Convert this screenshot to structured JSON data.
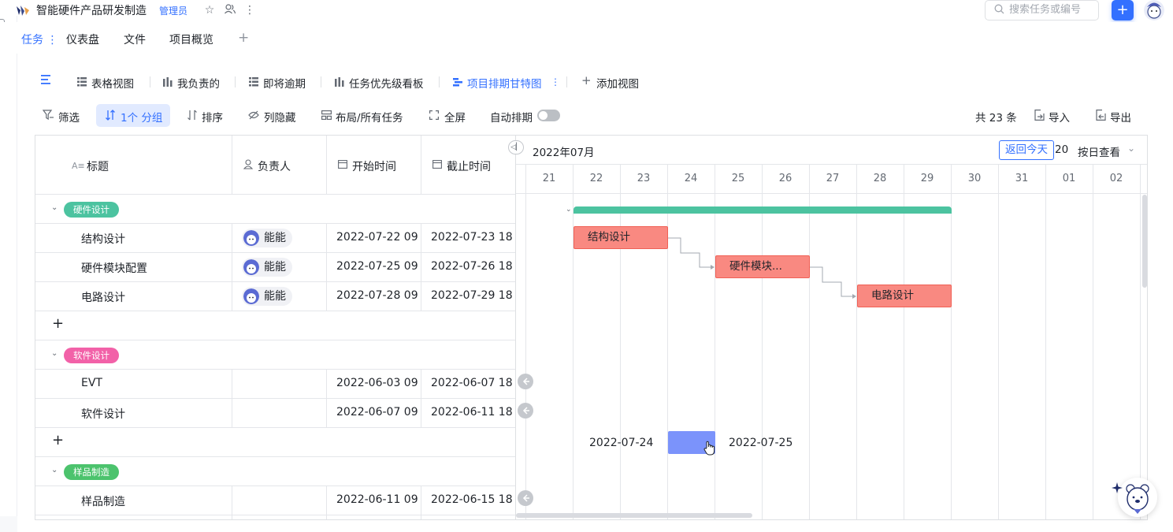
{
  "app": {
    "title": "智能硬件产品研发制造",
    "role": "管理员",
    "search_placeholder": "搜索任务或编号",
    "plus": "+"
  },
  "tabs": [
    {
      "label": "任务 ⋮",
      "active": true
    },
    {
      "label": "仪表盘"
    },
    {
      "label": "文件"
    },
    {
      "label": "项目概览"
    },
    {
      "label": "+"
    }
  ],
  "views": [
    {
      "label": "表格视图",
      "icon": "table-icon"
    },
    {
      "label": "我负责的",
      "icon": "board-icon"
    },
    {
      "label": "即将逾期",
      "icon": "table-icon"
    },
    {
      "label": "任务优先级看板",
      "icon": "board-icon"
    },
    {
      "label": "项目排期甘特图",
      "icon": "gantt-icon",
      "active": true
    },
    {
      "label": "添加视图",
      "icon": "plus-icon"
    }
  ],
  "toolbar": {
    "filter": "筛选",
    "group": "1个 分组",
    "sort": "排序",
    "hide": "列隐藏",
    "layout": "布局/所有任务",
    "fullscreen": "全屏",
    "auto": "自动排期",
    "auto_on": false,
    "count": "共 23 条",
    "import": "导入",
    "export": "导出"
  },
  "columns": {
    "title": "标题",
    "owner": "负责人",
    "start": "开始时间",
    "end": "截止时间"
  },
  "groups": [
    {
      "name": "硬件设计",
      "color": "#4cc3a0",
      "rows": [
        {
          "title": "结构设计",
          "owner": "能能",
          "start": "2022-07-22 09",
          "end": "2022-07-23 18"
        },
        {
          "title": "硬件模块配置",
          "owner": "能能",
          "start": "2022-07-25 09",
          "end": "2022-07-26 18"
        },
        {
          "title": "电路设计",
          "owner": "能能",
          "start": "2022-07-28 09",
          "end": "2022-07-29 18"
        }
      ]
    },
    {
      "name": "软件设计",
      "color": "#f261a8",
      "rows": [
        {
          "title": "EVT",
          "owner": "",
          "start": "2022-06-03 09",
          "end": "2022-06-07 18"
        },
        {
          "title": "软件设计",
          "owner": "",
          "start": "2022-06-07 09",
          "end": "2022-06-11 18"
        }
      ]
    },
    {
      "name": "样品制造",
      "color": "#4cc36d",
      "rows": [
        {
          "title": "样品制造",
          "owner": "",
          "start": "2022-06-11 09",
          "end": "2022-06-15 18"
        }
      ]
    }
  ],
  "add_row": "+",
  "gantt": {
    "month": "2022年07月",
    "today": "返回今天",
    "year_stub": "20:",
    "mode": "按日查看",
    "days": [
      "21",
      "22",
      "23",
      "24",
      "25",
      "26",
      "27",
      "28",
      "29",
      "30",
      "31",
      "01",
      "02"
    ],
    "bars": [
      {
        "label": "结构设计"
      },
      {
        "label": "硬件模块..."
      },
      {
        "label": "电路设计"
      }
    ],
    "drag_start": "2022-07-24",
    "drag_end": "2022-07-25"
  },
  "colors": {
    "accent": "#3370ff",
    "bar_fill": "#f98981",
    "group_bar": "#4cc3a0",
    "drag_bar": "#7b93fb"
  }
}
